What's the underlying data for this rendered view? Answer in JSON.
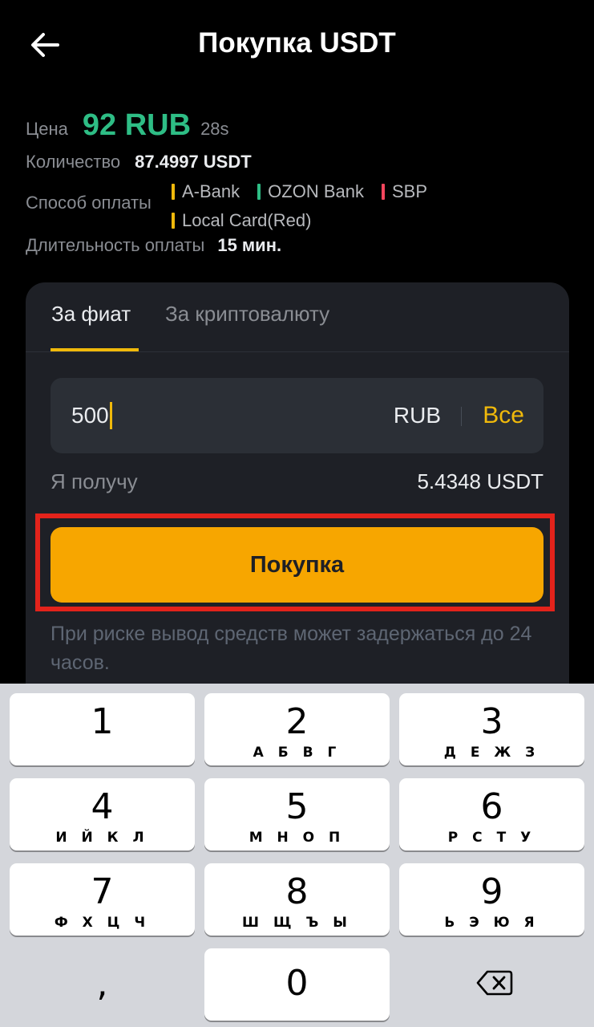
{
  "header": {
    "title": "Покупка USDT"
  },
  "offer": {
    "price_label": "Цена",
    "price_value": "92 RUB",
    "price_timer": "28s",
    "quantity_label": "Количество",
    "quantity_value": "87.4997 USDT",
    "payment_label": "Способ оплаты",
    "payment_methods": [
      {
        "name": "A-Bank",
        "color": "#f0b90b"
      },
      {
        "name": "OZON Bank",
        "color": "#2ebd85"
      },
      {
        "name": "SBP",
        "color": "#f6465d"
      },
      {
        "name": "Local Card(Red)",
        "color": "#f0b90b"
      }
    ],
    "duration_label": "Длительность оплаты",
    "duration_value": "15 мин."
  },
  "tabs": [
    {
      "label": "За фиат",
      "active": true
    },
    {
      "label": "За криптовалюту",
      "active": false
    }
  ],
  "amount": {
    "value": "500",
    "currency": "RUB",
    "all_label": "Все"
  },
  "receive": {
    "label": "Я получу",
    "value": "5.4348 USDT"
  },
  "buy_button": {
    "label": "Покупка"
  },
  "risk_note": "При риске вывод средств может задержаться до 24 часов.",
  "keyboard": {
    "keys": [
      {
        "num": "1",
        "letters": ""
      },
      {
        "num": "2",
        "letters": "А Б В Г"
      },
      {
        "num": "3",
        "letters": "Д Е Ж З"
      },
      {
        "num": "4",
        "letters": "И Й К Л"
      },
      {
        "num": "5",
        "letters": "М Н О П"
      },
      {
        "num": "6",
        "letters": "Р С Т У"
      },
      {
        "num": "7",
        "letters": "Ф Х Ц Ч"
      },
      {
        "num": "8",
        "letters": "Ш Щ Ъ Ы"
      },
      {
        "num": "9",
        "letters": "Ь Э Ю Я"
      },
      {
        "num": "0",
        "letters": ""
      }
    ],
    "comma": ","
  },
  "colors": {
    "accent": "#f0b90b",
    "buy_button": "#f7a600",
    "price": "#2ebd85",
    "highlight": "#e3231b"
  }
}
